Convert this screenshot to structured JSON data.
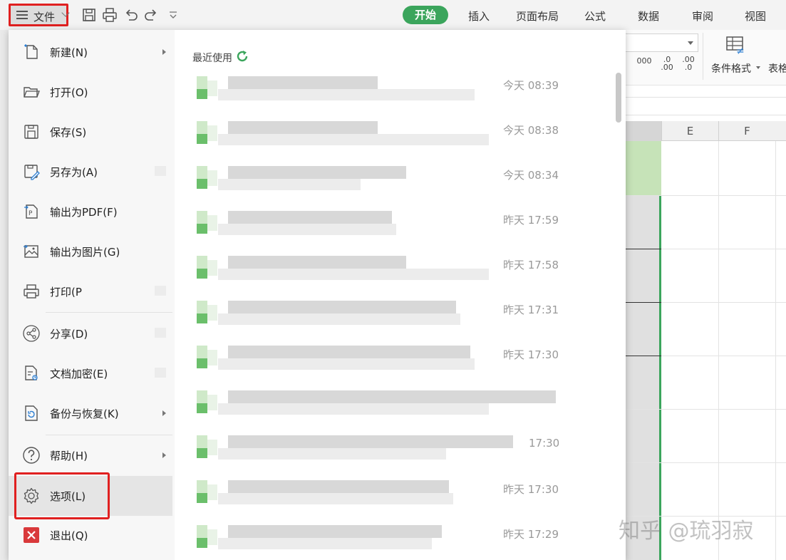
{
  "topbar": {
    "file_label": "文件",
    "tabs": [
      "开始",
      "插入",
      "页面布局",
      "公式",
      "数据",
      "审阅",
      "视图"
    ]
  },
  "ribbon": {
    "number_formats": [
      "000",
      ".0\n.00",
      ".00\n.0"
    ],
    "conditional_format_label": "条件格式",
    "table_label": "表格"
  },
  "sheet": {
    "columns": [
      "E",
      "F"
    ]
  },
  "menu": {
    "items": [
      {
        "label": "新建(N)",
        "icon": "new-file-icon",
        "submenu": true
      },
      {
        "label": "打开(O)",
        "icon": "folder-open-icon",
        "submenu": false
      },
      {
        "label": "保存(S)",
        "icon": "save-icon",
        "submenu": false
      },
      {
        "label": "另存为(A)",
        "icon": "save-as-icon",
        "submenu": false
      },
      {
        "label": "输出为PDF(F)",
        "icon": "export-pdf-icon",
        "submenu": false
      },
      {
        "label": "输出为图片(G)",
        "icon": "export-image-icon",
        "submenu": false
      },
      {
        "label": "打印(P",
        "icon": "print-icon",
        "submenu": false
      },
      {
        "label": "分享(D)",
        "icon": "share-icon",
        "submenu": false
      },
      {
        "label": "文档加密(E)",
        "icon": "encrypt-icon",
        "submenu": false
      },
      {
        "label": "备份与恢复(K)",
        "icon": "backup-icon",
        "submenu": true
      },
      {
        "label": "帮助(H)",
        "icon": "help-icon",
        "submenu": true
      },
      {
        "label": "选项(L)",
        "icon": "gear-icon",
        "submenu": false
      },
      {
        "label": "退出(Q)",
        "icon": "exit-icon",
        "submenu": false
      }
    ]
  },
  "recent": {
    "title": "最近使用",
    "files": [
      {
        "time": "今天 08:39"
      },
      {
        "time": "今天 08:38"
      },
      {
        "time": "今天 08:34"
      },
      {
        "time": "昨天 17:59"
      },
      {
        "time": "昨天 17:58"
      },
      {
        "time": "昨天 17:31"
      },
      {
        "time": "昨天 17:30"
      },
      {
        "time": ""
      },
      {
        "time": "17:30"
      },
      {
        "time": "昨天 17:30"
      },
      {
        "time": "昨天 17:29"
      }
    ]
  },
  "watermark": "知乎 @琉羽寂"
}
